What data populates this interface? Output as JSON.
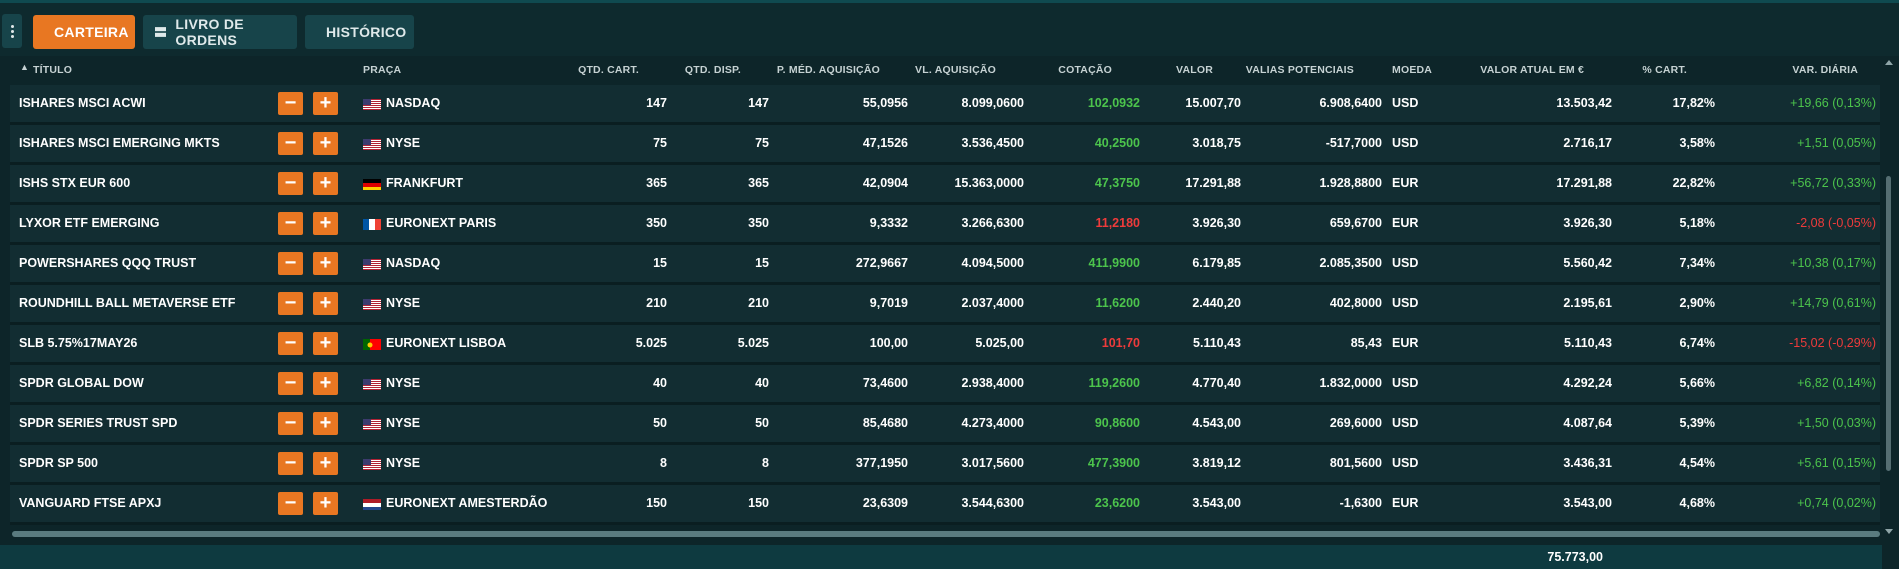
{
  "toolbar": {
    "carteira_label": "CARTEIRA",
    "livro_label": "LIVRO DE ORDENS",
    "historico_label": "HISTÓRICO"
  },
  "columns": {
    "titulo": "TÍTULO",
    "praca": "PRAÇA",
    "qtd_cart": "QTD. CART.",
    "qtd_disp": "QTD. DISP.",
    "p_med": "P. MÉD. AQUISIÇÃO",
    "vl_aq": "VL. AQUISIÇÃO",
    "cotacao": "COTAÇÃO",
    "valor": "VALOR",
    "valias": "VALIAS POTENCIAIS",
    "moeda": "MOEDA",
    "valor_eur": "VALOR ATUAL EM €",
    "pct_cart": "% CART.",
    "var_diaria": "VAR. DIÁRIA"
  },
  "buttons": {
    "minus": "−",
    "plus": "+"
  },
  "colors": {
    "accent": "#e87722",
    "positive": "#4cc44c",
    "negative": "#ee3b3b"
  },
  "rows": [
    {
      "titulo": "ISHARES MSCI ACWI",
      "flag": "us",
      "praca": "NASDAQ",
      "qtd_cart": "147",
      "qtd_disp": "147",
      "p_med": "55,0956",
      "vl_aq": "8.099,0600",
      "cotacao": "102,0932",
      "cot_dir": "up",
      "valor": "15.007,70",
      "valias": "6.908,6400",
      "moeda": "USD",
      "valor_eur": "13.503,42",
      "pct": "17,82%",
      "var": "+19,66 (0,13%)",
      "var_dir": "up"
    },
    {
      "titulo": "ISHARES MSCI EMERGING MKTS",
      "flag": "us",
      "praca": "NYSE",
      "qtd_cart": "75",
      "qtd_disp": "75",
      "p_med": "47,1526",
      "vl_aq": "3.536,4500",
      "cotacao": "40,2500",
      "cot_dir": "up",
      "valor": "3.018,75",
      "valias": "-517,7000",
      "moeda": "USD",
      "valor_eur": "2.716,17",
      "pct": "3,58%",
      "var": "+1,51 (0,05%)",
      "var_dir": "up"
    },
    {
      "titulo": "ISHS STX EUR 600",
      "flag": "de",
      "praca": "FRANKFURT",
      "qtd_cart": "365",
      "qtd_disp": "365",
      "p_med": "42,0904",
      "vl_aq": "15.363,0000",
      "cotacao": "47,3750",
      "cot_dir": "up",
      "valor": "17.291,88",
      "valias": "1.928,8800",
      "moeda": "EUR",
      "valor_eur": "17.291,88",
      "pct": "22,82%",
      "var": "+56,72 (0,33%)",
      "var_dir": "up"
    },
    {
      "titulo": "LYXOR ETF EMERGING",
      "flag": "fr",
      "praca": "EURONEXT PARIS",
      "qtd_cart": "350",
      "qtd_disp": "350",
      "p_med": "9,3332",
      "vl_aq": "3.266,6300",
      "cotacao": "11,2180",
      "cot_dir": "down",
      "valor": "3.926,30",
      "valias": "659,6700",
      "moeda": "EUR",
      "valor_eur": "3.926,30",
      "pct": "5,18%",
      "var": "-2,08 (-0,05%)",
      "var_dir": "down"
    },
    {
      "titulo": "POWERSHARES QQQ TRUST",
      "flag": "us",
      "praca": "NASDAQ",
      "qtd_cart": "15",
      "qtd_disp": "15",
      "p_med": "272,9667",
      "vl_aq": "4.094,5000",
      "cotacao": "411,9900",
      "cot_dir": "up",
      "valor": "6.179,85",
      "valias": "2.085,3500",
      "moeda": "USD",
      "valor_eur": "5.560,42",
      "pct": "7,34%",
      "var": "+10,38 (0,17%)",
      "var_dir": "up"
    },
    {
      "titulo": "ROUNDHILL BALL METAVERSE ETF",
      "flag": "us",
      "praca": "NYSE",
      "qtd_cart": "210",
      "qtd_disp": "210",
      "p_med": "9,7019",
      "vl_aq": "2.037,4000",
      "cotacao": "11,6200",
      "cot_dir": "up",
      "valor": "2.440,20",
      "valias": "402,8000",
      "moeda": "USD",
      "valor_eur": "2.195,61",
      "pct": "2,90%",
      "var": "+14,79 (0,61%)",
      "var_dir": "up"
    },
    {
      "titulo": "SLB 5.75%17MAY26",
      "flag": "pt",
      "praca": "EURONEXT LISBOA",
      "qtd_cart": "5.025",
      "qtd_disp": "5.025",
      "p_med": "100,00",
      "vl_aq": "5.025,00",
      "cotacao": "101,70",
      "cot_dir": "down",
      "valor": "5.110,43",
      "valias": "85,43",
      "moeda": "EUR",
      "valor_eur": "5.110,43",
      "pct": "6,74%",
      "var": "-15,02 (-0,29%)",
      "var_dir": "down"
    },
    {
      "titulo": "SPDR GLOBAL DOW",
      "flag": "us",
      "praca": "NYSE",
      "qtd_cart": "40",
      "qtd_disp": "40",
      "p_med": "73,4600",
      "vl_aq": "2.938,4000",
      "cotacao": "119,2600",
      "cot_dir": "up",
      "valor": "4.770,40",
      "valias": "1.832,0000",
      "moeda": "USD",
      "valor_eur": "4.292,24",
      "pct": "5,66%",
      "var": "+6,82 (0,14%)",
      "var_dir": "up"
    },
    {
      "titulo": "SPDR SERIES TRUST SPD",
      "flag": "us",
      "praca": "NYSE",
      "qtd_cart": "50",
      "qtd_disp": "50",
      "p_med": "85,4680",
      "vl_aq": "4.273,4000",
      "cotacao": "90,8600",
      "cot_dir": "up",
      "valor": "4.543,00",
      "valias": "269,6000",
      "moeda": "USD",
      "valor_eur": "4.087,64",
      "pct": "5,39%",
      "var": "+1,50 (0,03%)",
      "var_dir": "up"
    },
    {
      "titulo": "SPDR SP 500",
      "flag": "us",
      "praca": "NYSE",
      "qtd_cart": "8",
      "qtd_disp": "8",
      "p_med": "377,1950",
      "vl_aq": "3.017,5600",
      "cotacao": "477,3900",
      "cot_dir": "up",
      "valor": "3.819,12",
      "valias": "801,5600",
      "moeda": "USD",
      "valor_eur": "3.436,31",
      "pct": "4,54%",
      "var": "+5,61 (0,15%)",
      "var_dir": "up"
    },
    {
      "titulo": "VANGUARD FTSE APXJ",
      "flag": "nl",
      "praca": "EURONEXT AMESTERDÃO",
      "qtd_cart": "150",
      "qtd_disp": "150",
      "p_med": "23,6309",
      "vl_aq": "3.544,6300",
      "cotacao": "23,6200",
      "cot_dir": "up",
      "valor": "3.543,00",
      "valias": "-1,6300",
      "moeda": "EUR",
      "valor_eur": "3.543,00",
      "pct": "4,68%",
      "var": "+0,74 (0,02%)",
      "var_dir": "up"
    }
  ],
  "footer": {
    "total": "75.773,00"
  }
}
